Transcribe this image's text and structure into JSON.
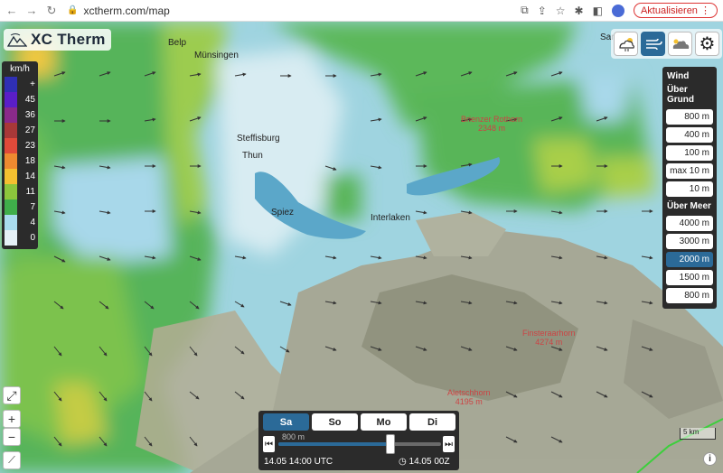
{
  "browser": {
    "url": "xctherm.com/map",
    "update_label": "Aktualisieren"
  },
  "app": {
    "title": "XC Therm"
  },
  "legend": {
    "unit": "km/h",
    "items": [
      {
        "label": "+",
        "color": "#2f2fb4"
      },
      {
        "label": "45",
        "color": "#5a1ec8"
      },
      {
        "label": "36",
        "color": "#8a2a8a"
      },
      {
        "label": "27",
        "color": "#a83838"
      },
      {
        "label": "23",
        "color": "#e04a3a"
      },
      {
        "label": "18",
        "color": "#ee8a30"
      },
      {
        "label": "14",
        "color": "#f4c030"
      },
      {
        "label": "11",
        "color": "#8cc63c"
      },
      {
        "label": "7",
        "color": "#3fae4a"
      },
      {
        "label": "4",
        "color": "#a9dcee"
      },
      {
        "label": "0",
        "color": "#e6f1f7"
      }
    ]
  },
  "places": [
    {
      "name": "Belp"
    },
    {
      "name": "Münsingen"
    },
    {
      "name": "Steffisburg"
    },
    {
      "name": "Thun"
    },
    {
      "name": "Spiez"
    },
    {
      "name": "Interlaken"
    },
    {
      "name": "Brienzer Rothorn",
      "elev": "2348 m"
    },
    {
      "name": "Finsteraarhorn",
      "elev": "4274 m"
    },
    {
      "name": "Aletschhorn",
      "elev": "4195 m"
    },
    {
      "name": "Sarr"
    }
  ],
  "wind_panel": {
    "title": "Wind",
    "group1_label": "Über Grund",
    "group1": [
      "800 m",
      "400 m",
      "100 m",
      "max 10 m",
      "10 m"
    ],
    "group2_label": "Über Meer",
    "group2": [
      "4000 m",
      "3000 m",
      "2000 m",
      "1500 m",
      "800 m"
    ],
    "selected": "2000 m"
  },
  "timeline": {
    "days": [
      "Sa",
      "So",
      "Mo",
      "Di"
    ],
    "active_day": "Sa",
    "elevation_label": "800 m",
    "start_time": "14.05 14:00 UTC",
    "end_time": "14.05 00Z",
    "position": 0.69
  },
  "scale_label": "5 km",
  "info_label": "i",
  "colors": {
    "accent": "#2b6a98",
    "panel": "#2b2b2b"
  }
}
